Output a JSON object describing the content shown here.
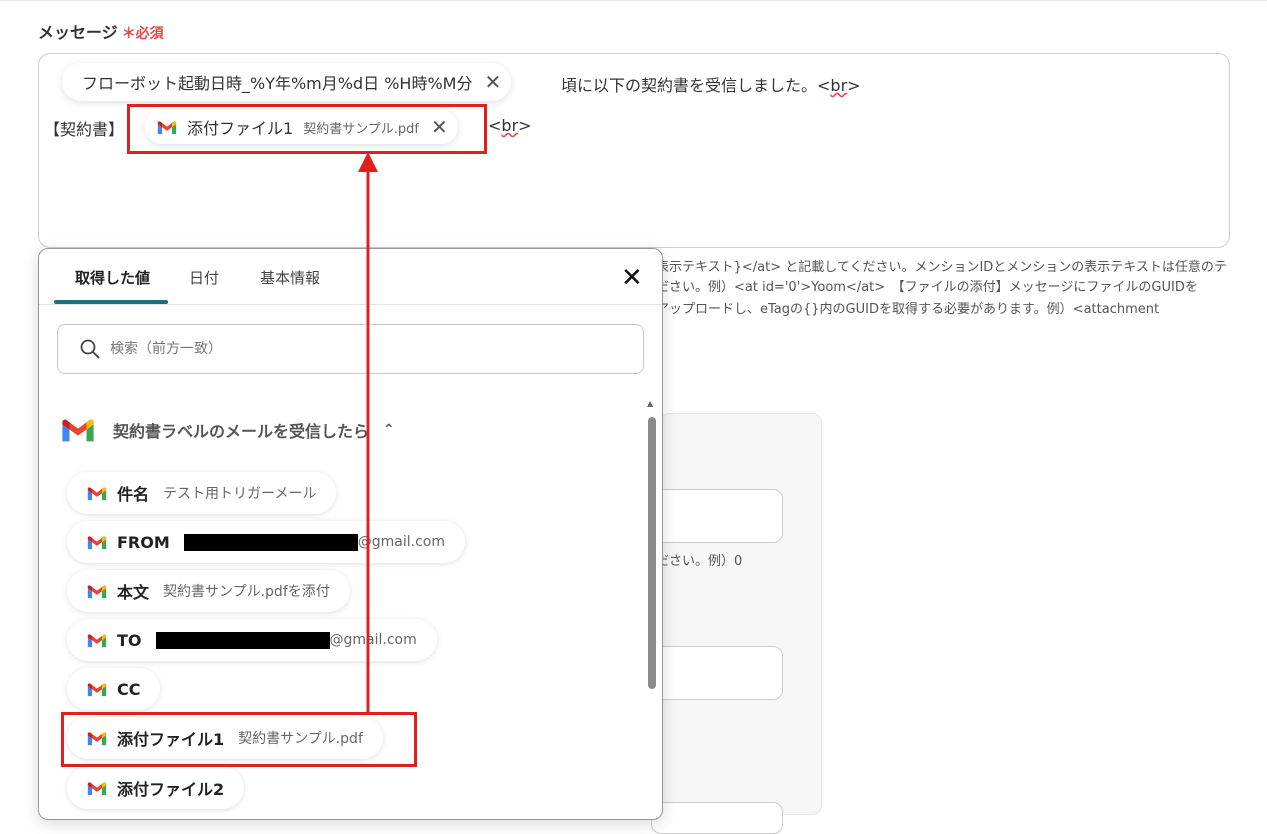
{
  "field": {
    "label": "メッセージ",
    "required": "＊必須"
  },
  "message": {
    "token1": "フローボット起動日時_%Y年%m月%d日 %H時%M分",
    "line1_text": "頃に以下の契約書を受信しました。",
    "br": "br",
    "line2_label": "【契約書】",
    "token2_name": "添付ファイル1",
    "token2_value": "契約書サンプル.pdf",
    "close_glyph": "✕"
  },
  "help": {
    "line1": "表示テキスト}</at> と記載してください。メンションIDとメンションの表示テキストは任意のテ",
    "line2": "ださい。例）<at id='0'>Yoom</at>　【ファイルの添付】メッセージにファイルのGUIDを",
    "line3": "アップロードし、eTagの{}内のGUIDを取得する必要があります。例）<attachment",
    "hint2": "ださい。例）0"
  },
  "popup": {
    "tabs": [
      "取得した値",
      "日付",
      "基本情報"
    ],
    "close": "✕",
    "search_placeholder": "検索（前方一致）",
    "group_title": "契約書ラベルのメールを受信したら",
    "group_chevron": "⌃",
    "items": [
      {
        "name": "件名",
        "value": "テスト用トリガーメール"
      },
      {
        "name": "FROM",
        "value": "@gmail.com"
      },
      {
        "name": "本文",
        "value": "契約書サンプル.pdfを添付"
      },
      {
        "name": "TO",
        "value": "@gmail.com"
      },
      {
        "name": "CC",
        "value": ""
      },
      {
        "name": "添付ファイル1",
        "value": "契約書サンプル.pdf"
      },
      {
        "name": "添付ファイル2",
        "value": ""
      }
    ]
  },
  "colors": {
    "accent": "#1f6e7e",
    "highlight": "#e02020",
    "required": "#e5484d"
  },
  "icons": {
    "gmail": "gmail-icon",
    "search": "search-icon",
    "close": "close-icon"
  }
}
